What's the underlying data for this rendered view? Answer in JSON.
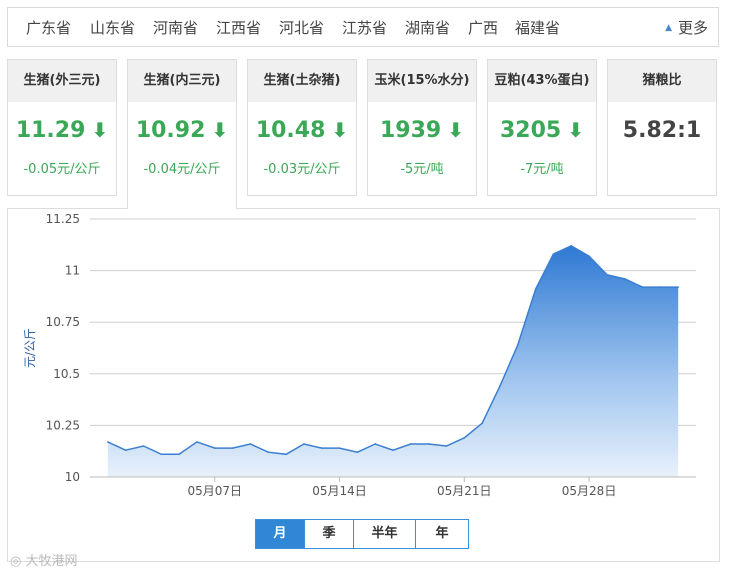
{
  "provinces": [
    "广东省",
    "山东省",
    "河南省",
    "江西省",
    "河北省",
    "江苏省",
    "湖南省",
    "广西",
    "福建省"
  ],
  "more_label": "更多",
  "cards": [
    {
      "title": "生猪(外三元)",
      "value": "11.29",
      "change": "-0.05元/公斤",
      "down": true
    },
    {
      "title": "生猪(内三元)",
      "value": "10.92",
      "change": "-0.04元/公斤",
      "down": true
    },
    {
      "title": "生猪(土杂猪)",
      "value": "10.48",
      "change": "-0.03元/公斤",
      "down": true
    },
    {
      "title": "玉米(15%水分)",
      "value": "1939",
      "change": "-5元/吨",
      "down": true
    },
    {
      "title": "豆粕(43%蛋白)",
      "value": "3205",
      "change": "-7元/吨",
      "down": true
    },
    {
      "title": "猪粮比",
      "value": "5.82:1",
      "change": "",
      "down": false
    }
  ],
  "arrow_glyph": "🡇",
  "range_buttons": [
    "月",
    "季",
    "半年",
    "年"
  ],
  "selected_range": "月",
  "watermark": "大牧港网",
  "colors": {
    "accent": "#2f87d6",
    "down": "#3aa856",
    "line": "#3b7fd0"
  },
  "chart_data": {
    "type": "area",
    "ylabel": "元/公斤",
    "ylim": [
      10,
      11.25
    ],
    "yticks": [
      10,
      10.25,
      10.5,
      10.75,
      11,
      11.25
    ],
    "xlim": [
      "2018-04-30",
      "2018-06-03"
    ],
    "xticks": [
      {
        "date": "2018-05-07",
        "label": "05月07日"
      },
      {
        "date": "2018-05-14",
        "label": "05月14日"
      },
      {
        "date": "2018-05-21",
        "label": "05月21日"
      },
      {
        "date": "2018-05-28",
        "label": "05月28日"
      }
    ],
    "x": [
      "2018-05-01",
      "2018-05-02",
      "2018-05-03",
      "2018-05-04",
      "2018-05-05",
      "2018-05-06",
      "2018-05-07",
      "2018-05-08",
      "2018-05-09",
      "2018-05-10",
      "2018-05-11",
      "2018-05-12",
      "2018-05-13",
      "2018-05-14",
      "2018-05-15",
      "2018-05-16",
      "2018-05-17",
      "2018-05-18",
      "2018-05-19",
      "2018-05-20",
      "2018-05-21",
      "2018-05-22",
      "2018-05-23",
      "2018-05-24",
      "2018-05-25",
      "2018-05-26",
      "2018-05-27",
      "2018-05-28",
      "2018-05-29",
      "2018-05-30",
      "2018-05-31",
      "2018-06-01",
      "2018-06-02"
    ],
    "values": [
      10.17,
      10.13,
      10.15,
      10.11,
      10.11,
      10.17,
      10.14,
      10.14,
      10.16,
      10.12,
      10.11,
      10.16,
      10.14,
      10.14,
      10.12,
      10.16,
      10.13,
      10.16,
      10.16,
      10.15,
      10.19,
      10.26,
      10.44,
      10.64,
      10.91,
      11.08,
      11.12,
      11.07,
      10.98,
      10.96,
      10.92,
      10.92,
      10.92
    ],
    "grid": true,
    "legend": "none"
  }
}
